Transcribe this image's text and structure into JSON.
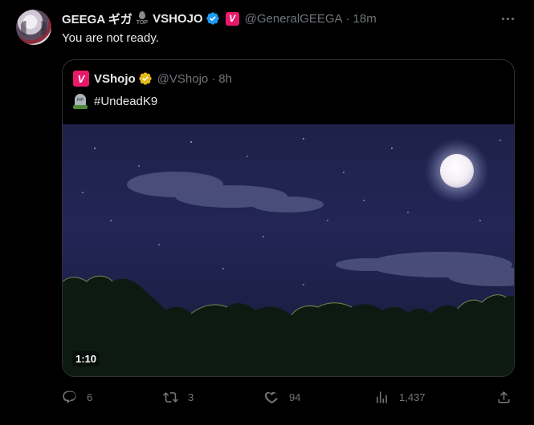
{
  "tweet": {
    "author_name": "GEEGA ギガ",
    "top_badge_text": "TOP",
    "author_affiliation": "VSHOJO",
    "vshojo_badge": "V",
    "handle": "@GeneralGEEGA",
    "separator": "·",
    "time": "18m",
    "text": "You are not ready.",
    "verified_color": "#1d9bf0",
    "brand_color": "#e8196b"
  },
  "quote": {
    "badge": "V",
    "name": "VShojo",
    "handle": "@VShojo",
    "separator": "·",
    "time": "8h",
    "text": "#UndeadK9",
    "emoji_icon": "headstone-icon",
    "tomb_text": "RIP",
    "video_duration": "1:10",
    "gold_check_color": "#e2b719"
  },
  "actions": {
    "replies": "6",
    "reposts": "3",
    "likes": "94",
    "views": "1,437"
  }
}
